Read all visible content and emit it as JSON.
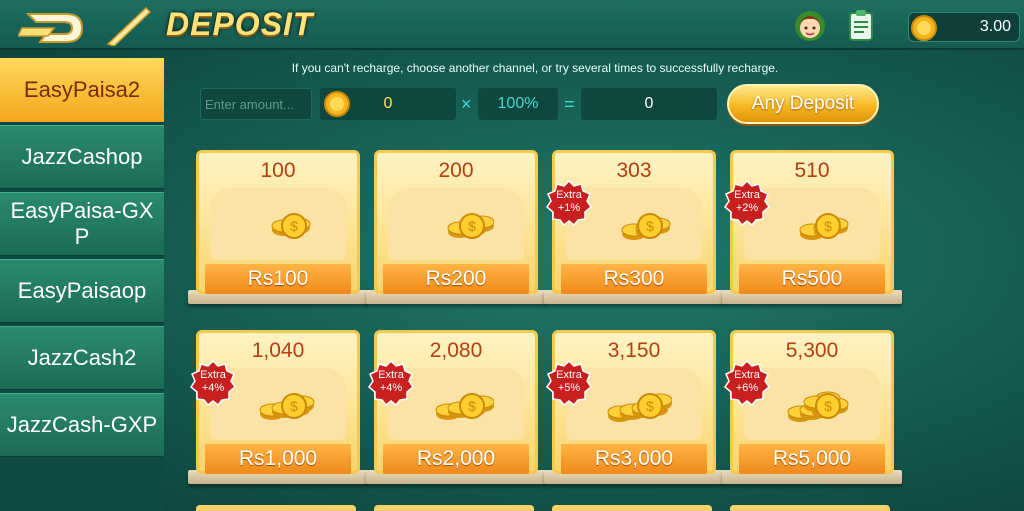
{
  "header": {
    "title": "DEPOSIT",
    "balance": "3.00"
  },
  "sidebar": {
    "items": [
      {
        "label": "EasyPaisa2",
        "active": true
      },
      {
        "label": "JazzCashop",
        "active": false
      },
      {
        "label": "EasyPaisa-GXP",
        "active": false
      },
      {
        "label": "EasyPaisaop",
        "active": false
      },
      {
        "label": "JazzCash2",
        "active": false
      },
      {
        "label": "JazzCash-GXP",
        "active": false
      }
    ]
  },
  "notice": "If you can't recharge, choose another channel, or try several times to successfully recharge.",
  "amount_row": {
    "placeholder": "Enter amount...",
    "coin_value": "0",
    "multiply": "×",
    "percent": "100%",
    "equals": "=",
    "result": "0",
    "any_deposit_label": "Any Deposit"
  },
  "packages": [
    {
      "coins": "100",
      "price": "Rs100",
      "extra": "",
      "pct": ""
    },
    {
      "coins": "200",
      "price": "Rs200",
      "extra": "",
      "pct": ""
    },
    {
      "coins": "303",
      "price": "Rs300",
      "extra": "Extra",
      "pct": "+1%"
    },
    {
      "coins": "510",
      "price": "Rs500",
      "extra": "Extra",
      "pct": "+2%"
    },
    {
      "coins": "1,040",
      "price": "Rs1,000",
      "extra": "Extra",
      "pct": "+4%"
    },
    {
      "coins": "2,080",
      "price": "Rs2,000",
      "extra": "Extra",
      "pct": "+4%"
    },
    {
      "coins": "3,150",
      "price": "Rs3,000",
      "extra": "Extra",
      "pct": "+5%"
    },
    {
      "coins": "5,300",
      "price": "Rs5,000",
      "extra": "Extra",
      "pct": "+6%"
    }
  ],
  "colors": {
    "accent_gold": "#f5b51e",
    "badge_red": "#c81f1f",
    "background_teal": "#14594f"
  }
}
